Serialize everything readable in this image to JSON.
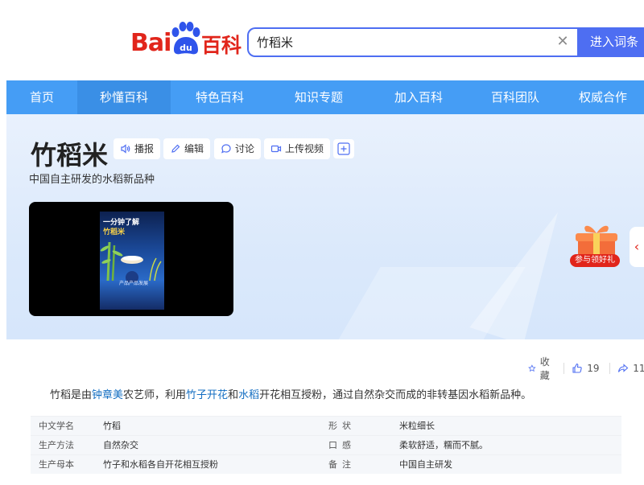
{
  "header": {
    "logo_bai": "Bai",
    "logo_du": "du",
    "logo_baike": "百科",
    "search": {
      "value": "竹稻米",
      "clear_icon": "close-icon"
    },
    "search_button": "进入词条"
  },
  "nav": {
    "items": [
      {
        "label": "首页"
      },
      {
        "label": "秒懂百科"
      },
      {
        "label": "特色百科"
      },
      {
        "label": "知识专题"
      },
      {
        "label": "加入百科"
      },
      {
        "label": "百科团队"
      },
      {
        "label": "权威合作"
      }
    ],
    "active_index": 1
  },
  "entry": {
    "title": "竹稻米",
    "subtitle": "中国自主研发的水稻新品种",
    "actions": [
      {
        "label": "播报",
        "icon": "speaker-icon"
      },
      {
        "label": "编辑",
        "icon": "pencil-icon"
      },
      {
        "label": "讨论",
        "icon": "chat-icon"
      },
      {
        "label": "上传视频",
        "icon": "video-camera-icon"
      }
    ],
    "add_icon": "plus-icon",
    "video": {
      "title_line1": "一分钟了解",
      "title_line2": "竹稻米",
      "caption": "产品产品发展"
    },
    "gift_label": "参与领好礼",
    "side_tab_icon": "chevron-left-icon"
  },
  "stats": {
    "favorite_label": "收藏",
    "likes": "19",
    "shares": "11"
  },
  "summary": {
    "part1": "竹稻是由",
    "link1": "钟章美",
    "part2": "农艺师，利用",
    "link2": "竹子开花",
    "part3": "和",
    "link3": "水稻",
    "part4": "开花相互授粉，通过自然杂交而成的非转基因水稻新品种。"
  },
  "info": {
    "rows": [
      {
        "k1": "中文学名",
        "v1": "竹稻",
        "k2": "形状",
        "v2": "米粒细长"
      },
      {
        "k1": "生产方法",
        "v1": "自然杂交",
        "k2": "口感",
        "v2": "柔软舒适，糯而不腻。"
      },
      {
        "k1": "生产母本",
        "v1": "竹子和水稻各自开花相互授粉",
        "k2": "备注",
        "v2": "中国自主研发"
      }
    ]
  },
  "colors": {
    "brand_red": "#e1251b",
    "brand_blue": "#4e6ef2",
    "nav_blue": "#459df5",
    "link_blue": "#136ec2"
  }
}
